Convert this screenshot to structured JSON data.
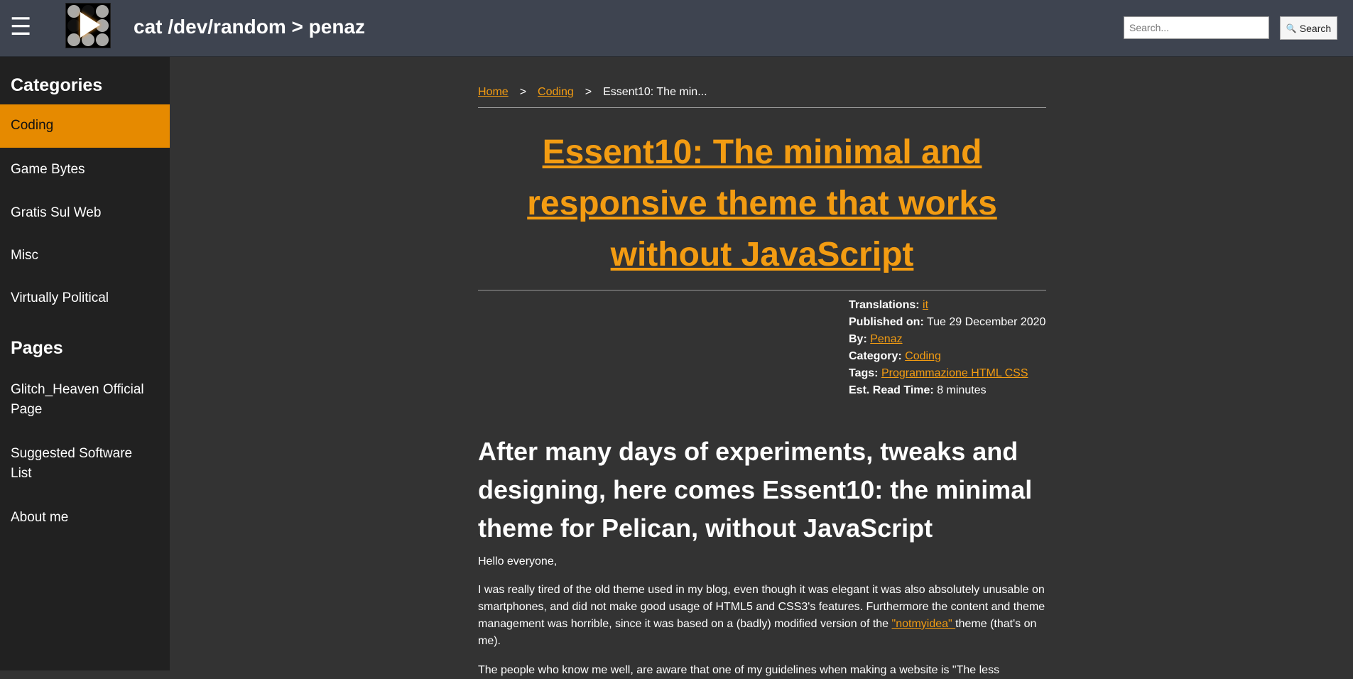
{
  "header": {
    "menu_icon": "☰",
    "site_title": "cat /dev/random > penaz",
    "search_placeholder": "Search...",
    "search_label": "Search",
    "search_icon": "🔍"
  },
  "sidebar": {
    "categories_heading": "Categories",
    "categories": [
      {
        "label": "Coding",
        "active": true
      },
      {
        "label": "Game Bytes"
      },
      {
        "label": "Gratis Sul Web"
      },
      {
        "label": "Misc"
      },
      {
        "label": "Virtually Political"
      }
    ],
    "pages_heading": "Pages",
    "pages": [
      {
        "label": "Glitch_Heaven Official Page"
      },
      {
        "label": "Suggested Software List"
      },
      {
        "label": "About me"
      }
    ]
  },
  "breadcrumb": {
    "home": "Home",
    "category": "Coding",
    "current": "Essent10: The min...",
    "separator": ">"
  },
  "article": {
    "title": "Essent10: The minimal and responsive theme that works without JavaScript",
    "meta": {
      "translations_label": "Translations:",
      "translations_value": "it",
      "published_label": "Published on:",
      "published_value": "Tue 29 December 2020",
      "by_label": "By:",
      "by_value": "Penaz",
      "category_label": "Category:",
      "category_value": "Coding",
      "tags_label": "Tags:",
      "tags_value": "Programmazione HTML CSS",
      "readtime_label": "Est. Read Time:",
      "readtime_value": "8 minutes"
    },
    "subtitle": "After many days of experiments, tweaks and designing, here comes Essent10: the minimal theme for Pelican, without JavaScript",
    "greeting": "Hello everyone,",
    "para_before_link": "I was really tired of the old theme used in my blog, even though it was elegant it was also absolutely unusable on smartphones, and did not make good usage of HTML5 and CSS3's features. Furthermore the content and theme management was horrible, since it was based on a (badly) modified version of the ",
    "para_link": "\"notmyidea\" ",
    "para_after_link": "theme (that's on me).",
    "para_cut": "The people who know me well, are aware that one of my guidelines when making a website is \"The less"
  }
}
